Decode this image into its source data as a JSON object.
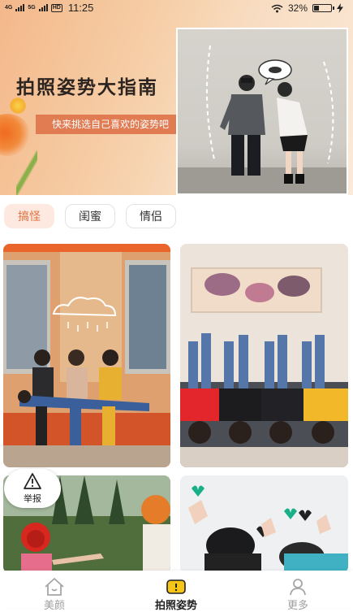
{
  "status_bar": {
    "network_1": "4G",
    "network_2": "5G",
    "hd_badge": "HD",
    "time": "11:25",
    "battery_text": "32%",
    "battery_level": 0.32,
    "icons": [
      "signal-icon",
      "wifi-icon",
      "battery-icon",
      "charging-icon"
    ]
  },
  "banner": {
    "title": "拍照姿势大指南",
    "subtitle": "快来挑选自己喜欢的姿势吧"
  },
  "tabs": [
    {
      "label": "搞怪",
      "active": true
    },
    {
      "label": "闺蜜",
      "active": false
    },
    {
      "label": "情侣",
      "active": false
    }
  ],
  "report": {
    "label": "举报",
    "icon": "warning-icon"
  },
  "bottom_nav": [
    {
      "label": "美颜",
      "icon": "house-icon"
    },
    {
      "label": "拍照姿势",
      "icon": "camera-pose-icon"
    },
    {
      "label": "更多",
      "icon": "user-icon"
    }
  ],
  "colors": {
    "accent": "#e0703f",
    "active_tab_bg": "#fde9df",
    "nav_active_icon": "#f5c518"
  }
}
